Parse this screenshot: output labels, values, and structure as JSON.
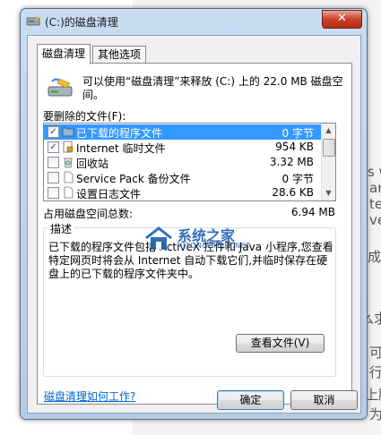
{
  "dialog": {
    "title": "(C:)的磁盘清理",
    "close_glyph": "✕"
  },
  "tabs": [
    {
      "label": "磁盘清理",
      "active": true
    },
    {
      "label": "其他选项",
      "active": false
    }
  ],
  "intro_text": "可以使用“磁盘清理”来释放  (C:) 上的 22.0 MB 磁盘空间。",
  "list_label": "要删除的文件(F):",
  "files": [
    {
      "name": "已下载的程序文件",
      "size": "0 字节",
      "checked": true,
      "selected": true,
      "icon": "folder-icon"
    },
    {
      "name": "Internet 临时文件",
      "size": "954 KB",
      "checked": true,
      "selected": false,
      "icon": "lock-file-icon"
    },
    {
      "name": "回收站",
      "size": "3.32 MB",
      "checked": false,
      "selected": false,
      "icon": "recycle-bin-icon"
    },
    {
      "name": "Service Pack 备份文件",
      "size": "0 字节",
      "checked": false,
      "selected": false,
      "icon": "file-icon"
    },
    {
      "name": "设置日志文件",
      "size": "28.6 KB",
      "checked": false,
      "selected": false,
      "icon": "file-icon"
    }
  ],
  "total": {
    "label": "占用磁盘空间总数:",
    "value": "6.94 MB"
  },
  "description": {
    "title": "描述",
    "text": "已下载的程序文件包括 ActiveX 控件和 Java 小程序,您查看特定网页时将会从 Internet 自动下载它们,并临时保存在硬盘上的已下载的程序文件夹中。"
  },
  "view_files_label": "查看文件(V)",
  "help_link": "磁盘清理如何工作?",
  "ok_label": "确定",
  "cancel_label": "取消",
  "watermark": {
    "text": "系统之家",
    "sub": "XITONGZHIJIA.NET"
  },
  "background_fragments": [
    "s w",
    "an",
    "ter",
    "ve",
    "成",
    "么求",
    "可",
    "行",
    "上肠",
    "为"
  ]
}
